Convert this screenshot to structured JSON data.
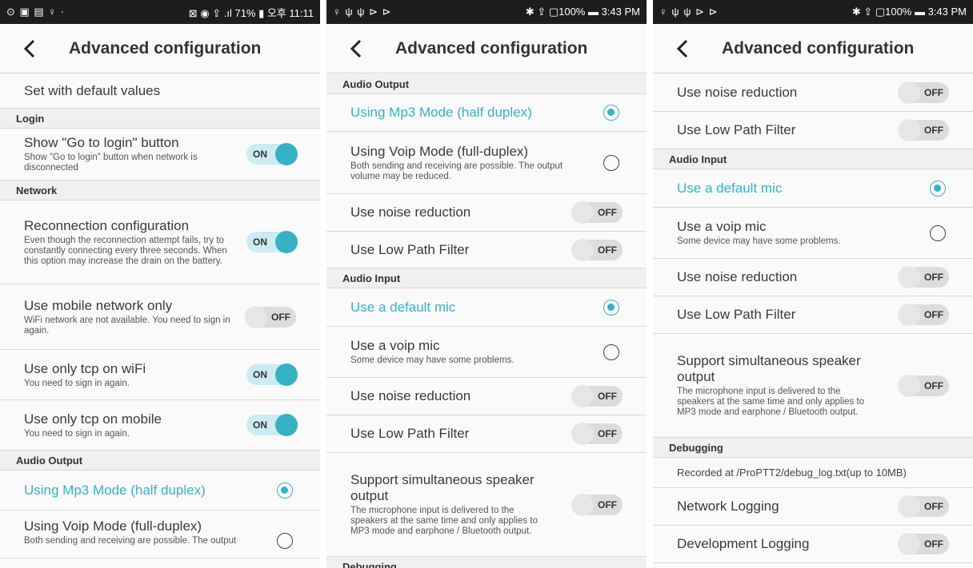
{
  "title": "Advanced configuration",
  "accent": "#36b1c6",
  "p1": {
    "status_left": "⊙ ▣ ▤ ♀ ·",
    "status_right": "⊠ ◉ ⇪ .ıl 71% ▮ 오후 11:11",
    "default_values": "Set with default values",
    "sec_login": "Login",
    "goto_login": {
      "title": "Show \"Go to login\" button",
      "sub": "Show \"Go to login\" button when network is disconnected",
      "toggle": "ON"
    },
    "sec_network": "Network",
    "reconnect": {
      "title": "Reconnection configuration",
      "sub": "Even though the reconnection attempt fails, try to constantly connecting every three seconds. When this option may increase the drain on the battery.",
      "toggle": "ON"
    },
    "mobile_only": {
      "title": "Use mobile network only",
      "sub": "WiFi network are not available. You need to sign in again.",
      "toggle": "OFF"
    },
    "tcp_wifi": {
      "title": "Use only tcp on wiFi",
      "sub": "You need to sign in again.",
      "toggle": "ON"
    },
    "tcp_mobile": {
      "title": "Use only tcp on mobile",
      "sub": "You need to sign in again.",
      "toggle": "ON"
    },
    "sec_audio_out": "Audio Output",
    "mp3": "Using Mp3 Mode (half duplex)",
    "voip": {
      "title": "Using Voip Mode (full-duplex)",
      "sub": "Both sending and receiving are possible. The output"
    }
  },
  "p2": {
    "status_left": "♀ ψ ψ ⊳ ⊳",
    "status_right": "✱ ⇪ ▢100% ▬ 3:43 PM",
    "sec_audio_out": "Audio Output",
    "mp3": "Using Mp3 Mode (half duplex)",
    "voip": {
      "title": "Using Voip Mode (full-duplex)",
      "sub": "Both sending and receiving are possible. The output volume may be reduced."
    },
    "noise1": {
      "title": "Use noise reduction",
      "toggle": "OFF"
    },
    "lpf1": {
      "title": "Use Low Path Filter",
      "toggle": "OFF"
    },
    "sec_audio_in": "Audio Input",
    "default_mic": "Use a default mic",
    "voip_mic": {
      "title": "Use a voip mic",
      "sub": "Some device may have some problems."
    },
    "noise2": {
      "title": "Use noise reduction",
      "toggle": "OFF"
    },
    "lpf2": {
      "title": "Use Low Path Filter",
      "toggle": "OFF"
    },
    "simul": {
      "title": "Support simultaneous speaker output",
      "sub": "The microphone input is delivered to the speakers at the same time and only applies to MP3 mode and earphone / Bluetooth output.",
      "toggle": "OFF"
    },
    "sec_debug_partial": "Debugging"
  },
  "p3": {
    "status_left": "♀ ψ ψ ⊳ ⊳",
    "status_right": "✱ ⇪ ▢100% ▬ 3:43 PM",
    "noise1": {
      "title": "Use noise reduction",
      "toggle": "OFF"
    },
    "lpf1": {
      "title": "Use Low Path Filter",
      "toggle": "OFF"
    },
    "sec_audio_in": "Audio Input",
    "default_mic": "Use a default mic",
    "voip_mic": {
      "title": "Use a voip mic",
      "sub": "Some device may have some problems."
    },
    "noise2": {
      "title": "Use noise reduction",
      "toggle": "OFF"
    },
    "lpf2": {
      "title": "Use Low Path Filter",
      "toggle": "OFF"
    },
    "simul": {
      "title": "Support simultaneous speaker output",
      "sub": "The microphone input is delivered to the speakers at the same time and only applies to MP3 mode and earphone / Bluetooth output.",
      "toggle": "OFF"
    },
    "sec_debug": "Debugging",
    "debug_path": "Recorded at /ProPTT2/debug_log.txt(up to 10MB)",
    "net_log": {
      "title": "Network Logging",
      "toggle": "OFF"
    },
    "dev_log": {
      "title": "Development Logging",
      "toggle": "OFF"
    }
  }
}
